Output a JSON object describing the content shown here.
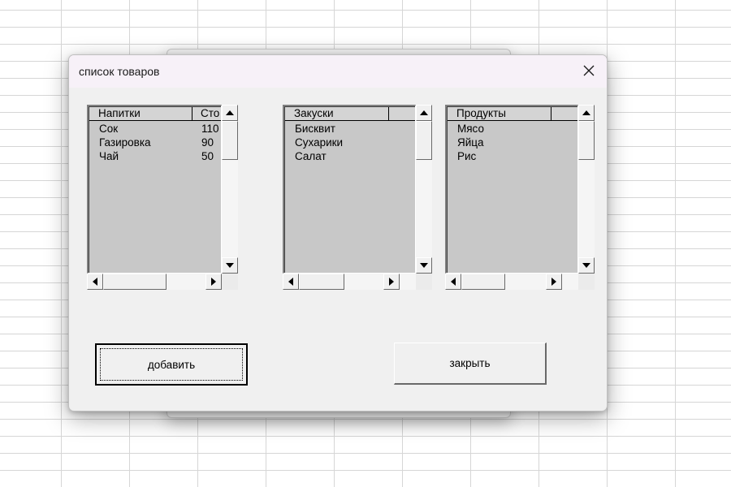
{
  "dialog": {
    "title": "список товаров",
    "close_icon": "close-icon"
  },
  "lists": [
    {
      "headers": [
        "Напитки",
        "Сто"
      ],
      "rows": [
        [
          "Сок",
          "110"
        ],
        [
          "Газировка",
          "90"
        ],
        [
          "Чай",
          "50"
        ]
      ]
    },
    {
      "headers": [
        "Закуски",
        ""
      ],
      "rows": [
        [
          "Бисквит",
          ""
        ],
        [
          "Сухарики",
          ""
        ],
        [
          "Салат",
          ""
        ]
      ]
    },
    {
      "headers": [
        "Продукты",
        ""
      ],
      "rows": [
        [
          "Мясо",
          ""
        ],
        [
          "Яйца",
          ""
        ],
        [
          "Рис",
          ""
        ]
      ]
    }
  ],
  "buttons": {
    "add_label": "добавить",
    "close_label": "закрыть"
  }
}
